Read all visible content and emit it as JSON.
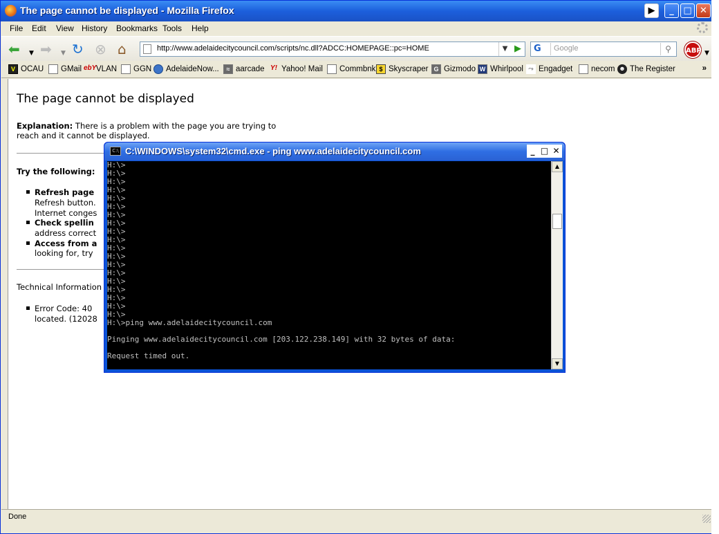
{
  "window": {
    "title": "The page cannot be displayed - Mozilla Firefox"
  },
  "menu": [
    "File",
    "Edit",
    "View",
    "History",
    "Bookmarks",
    "Tools",
    "Help"
  ],
  "nav": {
    "url": "http://www.adelaidecitycouncil.com/scripts/nc.dll?ADCC:HOMEPAGE::pc=HOME",
    "search_placeholder": "Google",
    "search_engine_glyph": "G",
    "abp_label": "ABP"
  },
  "bookmarks": [
    {
      "label": "OCAU",
      "icon": "ocau-icon",
      "glyph": "V"
    },
    {
      "label": "GMail",
      "icon": "page-icon",
      "glyph": ""
    },
    {
      "label": "VLAN",
      "icon": "ebay-icon",
      "glyph": "ebY"
    },
    {
      "label": "GGN",
      "icon": "page-icon",
      "glyph": ""
    },
    {
      "label": "AdelaideNow...",
      "icon": "globe-icon",
      "glyph": ""
    },
    {
      "label": "aarcade",
      "icon": "arcade-icon",
      "glyph": "≈"
    },
    {
      "label": "Yahoo! Mail",
      "icon": "yahoo-icon",
      "glyph": "Y!"
    },
    {
      "label": "Commbnk",
      "icon": "page-icon",
      "glyph": ""
    },
    {
      "label": "Skyscraper",
      "icon": "skyscraper-icon",
      "glyph": "$"
    },
    {
      "label": "Gizmodo",
      "icon": "gizmodo-icon",
      "glyph": "G"
    },
    {
      "label": "Whirlpool",
      "icon": "whirlpool-icon",
      "glyph": "W"
    },
    {
      "label": "Engadget",
      "icon": "rss-icon",
      "glyph": "⤳"
    },
    {
      "label": "necom",
      "icon": "page-icon",
      "glyph": ""
    },
    {
      "label": "The Register",
      "icon": "register-icon",
      "glyph": "☻"
    }
  ],
  "bookmarks_overflow": "»",
  "content": {
    "heading": "The page cannot be displayed",
    "explanation_label": "Explanation:",
    "explanation_text": " There is a problem with the page you are trying to reach and it cannot be displayed.",
    "try_heading": "Try the following:",
    "items": [
      {
        "bold": "Refresh page",
        "text": ""
      },
      {
        "bold": "",
        "text": "Refresh button."
      },
      {
        "bold": "",
        "text": "Internet conges"
      },
      {
        "bold": "Check spellin",
        "text": ""
      },
      {
        "bold": "",
        "text": "address correct"
      },
      {
        "bold": "Access from a",
        "text": ""
      },
      {
        "bold": "",
        "text": "looking for, try"
      }
    ],
    "tech_info": "Technical Information",
    "error_lines": [
      "Error Code: 40",
      "located. (12028"
    ]
  },
  "status": {
    "text": "Done"
  },
  "cmd": {
    "title": "C:\\WINDOWS\\system32\\cmd.exe - ping www.adelaidecitycouncil.com",
    "icon_glyph": "C:\\",
    "prompt_lines": [
      "H:\\>",
      "H:\\>",
      "H:\\>",
      "H:\\>",
      "H:\\>",
      "H:\\>",
      "H:\\>",
      "H:\\>",
      "H:\\>",
      "H:\\>",
      "H:\\>",
      "H:\\>",
      "H:\\>",
      "H:\\>",
      "H:\\>",
      "H:\\>",
      "H:\\>",
      "H:\\>",
      "H:\\>"
    ],
    "command": "H:\\>ping www.adelaidecitycouncil.com",
    "pinging": "Pinging www.adelaidecitycouncil.com [203.122.238.149] with 32 bytes of data:",
    "reply": "Request timed out."
  },
  "colors": {
    "xp_blue": "#0831d9",
    "console_bg": "#000000",
    "console_fg": "#c0c0c0"
  }
}
